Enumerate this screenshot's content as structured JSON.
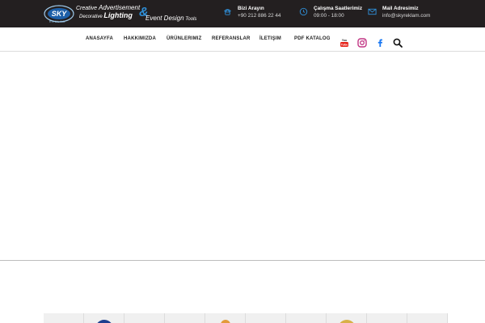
{
  "brand": {
    "line1_prefix": "Creative",
    "line1_word": "Advertisement",
    "line2_prefix": "Decorative",
    "line2_word": "Lighting",
    "ampersand": "&",
    "line3_word": "Event Design",
    "line3_suffix": "Tools",
    "badge_text": "SKY",
    "sub_text": "REKLAM"
  },
  "contacts": {
    "phone": {
      "label": "Bizi Arayın",
      "value": "+90 212 886 22 44",
      "icon": "phone-icon"
    },
    "hours": {
      "label": "Çalışma Saatlerimiz",
      "value": "09:00 - 18:00",
      "icon": "clock-icon"
    },
    "mail": {
      "label": "Mail Adresimiz",
      "value": "info@skyreklam.com",
      "icon": "mail-icon"
    }
  },
  "nav": {
    "items": [
      "ANASAYFA",
      "HAKKIMIZDA",
      "ÜRÜNLERIMIZ",
      "REFERANSLAR",
      "İLETIŞIM",
      "PDF KATALOG"
    ]
  },
  "social": [
    "youtube-icon",
    "instagram-icon",
    "facebook-icon",
    "search-icon"
  ],
  "colors": {
    "topbar": "#231f20",
    "accent": "#2f8fd8",
    "youtube": "#e62117",
    "instagram": "#c13584",
    "facebook": "#1877f2"
  }
}
